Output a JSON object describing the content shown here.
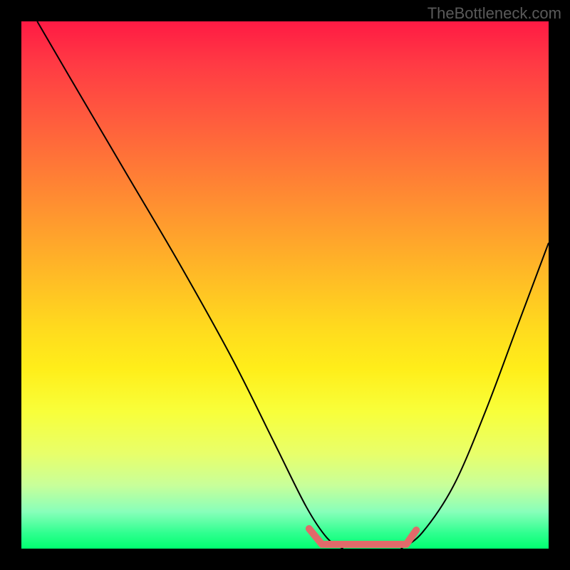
{
  "watermark": "TheBottleneck.com",
  "chart_data": {
    "type": "line",
    "title": "",
    "xlabel": "",
    "ylabel": "",
    "xlim": [
      0,
      100
    ],
    "ylim": [
      0,
      100
    ],
    "series": [
      {
        "name": "left-curve",
        "x": [
          3,
          10,
          20,
          30,
          40,
          48,
          54,
          58,
          61
        ],
        "values": [
          100,
          88,
          71,
          54,
          36,
          20,
          8,
          2,
          0
        ]
      },
      {
        "name": "right-curve",
        "x": [
          72,
          76,
          82,
          88,
          94,
          100
        ],
        "values": [
          0,
          3,
          12,
          26,
          42,
          58
        ]
      },
      {
        "name": "flat-bottom-marker",
        "x": [
          57,
          73
        ],
        "values": [
          0,
          0
        ],
        "color": "#e06a6a"
      }
    ],
    "annotations": []
  }
}
